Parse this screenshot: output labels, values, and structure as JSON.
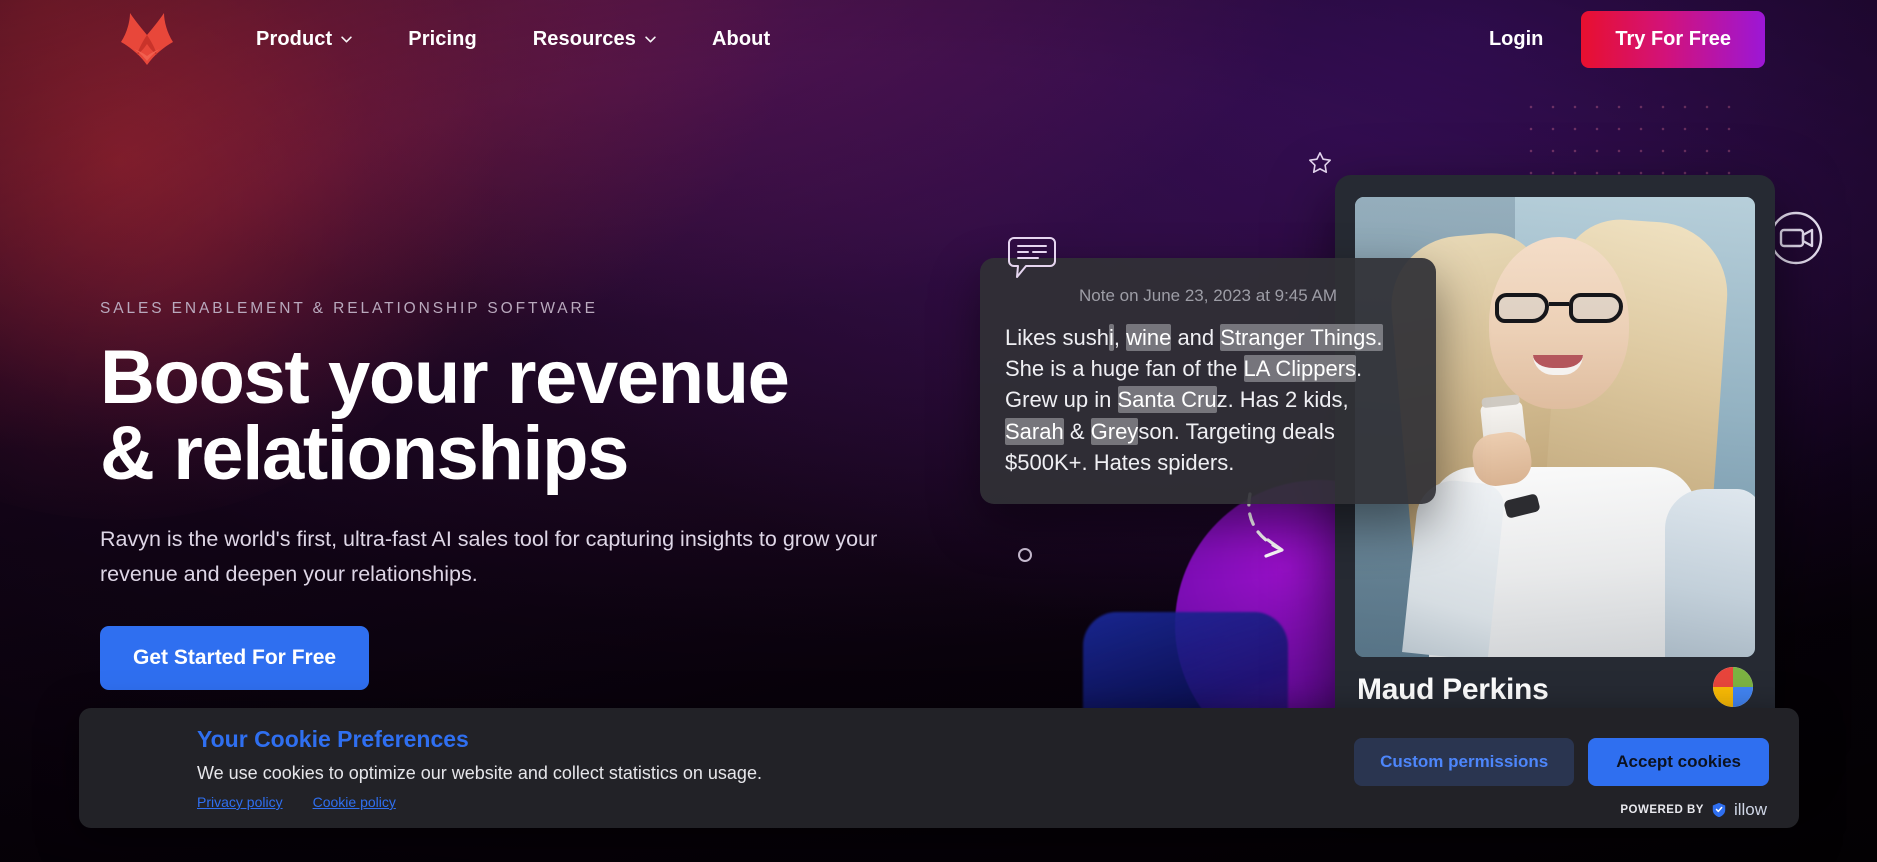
{
  "header": {
    "logo_icon": "ravyn-wings-logo",
    "nav": [
      {
        "label": "Product",
        "has_dropdown": true,
        "icon": "chevron-down-icon"
      },
      {
        "label": "Pricing",
        "has_dropdown": false,
        "icon": ""
      },
      {
        "label": "Resources",
        "has_dropdown": true,
        "icon": "chevron-down-icon"
      },
      {
        "label": "About",
        "has_dropdown": false,
        "icon": ""
      }
    ],
    "login_label": "Login",
    "cta_label": "Try For Free",
    "cta_gradient_from": "#e8102f",
    "cta_gradient_to": "#9c17d6"
  },
  "hero": {
    "eyebrow": "SALES ENABLEMENT & RELATIONSHIP SOFTWARE",
    "headline_line1": "Boost your revenue",
    "headline_line2": "& relationships",
    "subtext": "Ravyn is the world's first, ultra-fast AI sales tool for capturing insights to grow your revenue and deepen your relationships.",
    "cta_label": "Get Started For Free",
    "cta_color": "#2f6ff0"
  },
  "note_card": {
    "bubble_icon": "speech-bubble-icon",
    "meta": "Note on June 23, 2023 at 9:45 AM",
    "segments": [
      {
        "text": "Likes sush",
        "highlight": false
      },
      {
        "text": "i",
        "highlight": true
      },
      {
        "text": ", ",
        "highlight": false
      },
      {
        "text": "wine",
        "highlight": true
      },
      {
        "text": " and ",
        "highlight": false
      },
      {
        "text": "Stranger Things.",
        "highlight": true
      },
      {
        "text": " She is a huge fan of the ",
        "highlight": false
      },
      {
        "text": "LA Clippers",
        "highlight": true
      },
      {
        "text": ". Grew up in ",
        "highlight": false
      },
      {
        "text": "Santa Cru",
        "highlight": true
      },
      {
        "text": "z. Has 2 kids, ",
        "highlight": false
      },
      {
        "text": "Sarah",
        "highlight": true
      },
      {
        "text": " & ",
        "highlight": false
      },
      {
        "text": "Grey",
        "highlight": true
      },
      {
        "text": "son. Targeting deals $500K+. Hates spiders.",
        "highlight": false
      }
    ],
    "plain_text": "Likes sushi, wine and Stranger Things. She is a huge fan of the LA Clippers. Grew up in Santa Cruz. Has 2 kids, Sarah & Greyson. Targeting deals $500K+. Hates spiders."
  },
  "person_card": {
    "name": "Maud Perkins",
    "badge_icon": "google-contacts-icon",
    "photo_alt": "smiling-woman-with-glasses-holding-coffee-cup"
  },
  "decorations": {
    "star_icon": "star-sparkle-icon",
    "circle_icon": "small-circle-icon",
    "arrow_icon": "dashed-curved-arrow-icon",
    "camera_icon": "video-camera-icon",
    "dot_grid": "dot-grid-pattern",
    "blob_purple_color": "#8a10bd",
    "blob_blue_color": "#1a2896"
  },
  "cookie_banner": {
    "title": "Your Cookie Preferences",
    "description": "We use cookies to optimize our website and collect statistics on usage.",
    "privacy_link": "Privacy policy",
    "cookie_link": "Cookie policy",
    "custom_label": "Custom permissions",
    "accept_label": "Accept cookies",
    "powered_label": "POWERED BY",
    "powered_name": "illow",
    "powered_icon": "illow-shield-icon",
    "accent_color": "#2f6ff0"
  }
}
